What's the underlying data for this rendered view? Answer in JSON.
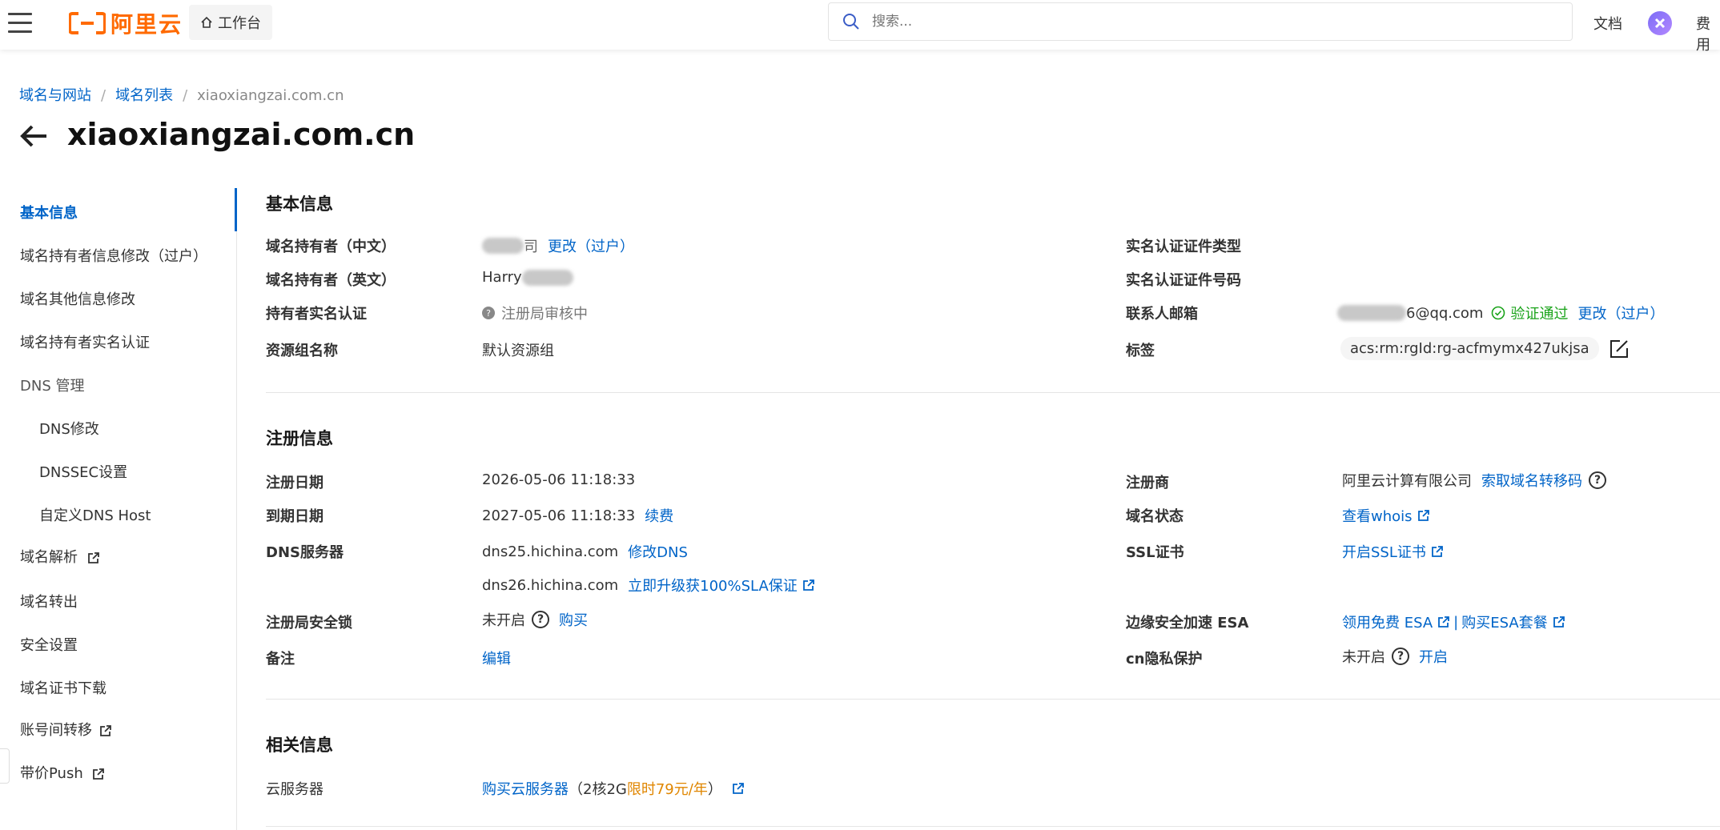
{
  "topbar": {
    "logo_text": "阿里云",
    "workbench_label": "工作台",
    "search_placeholder": "搜索...",
    "docs_label": "文档",
    "fee_label": "费用"
  },
  "header": {
    "breadcrumb": [
      "域名与网站",
      "域名列表",
      "xiaoxiangzai.com.cn"
    ],
    "title": "xiaoxiangzai.com.cn"
  },
  "sidenav": {
    "items": [
      {
        "label": "基本信息",
        "active": true
      },
      {
        "label": "域名持有者信息修改（过户）"
      },
      {
        "label": "域名其他信息修改"
      },
      {
        "label": "域名持有者实名认证"
      },
      {
        "label": "DNS 管理"
      },
      {
        "label": "DNS修改"
      },
      {
        "label": "DNSSEC设置"
      },
      {
        "label": "自定义DNS Host"
      },
      {
        "label": "域名解析"
      },
      {
        "label": "域名转出"
      },
      {
        "label": "安全设置"
      },
      {
        "label": "域名证书下载"
      },
      {
        "label": "账号间转移"
      },
      {
        "label": "带价Push"
      }
    ]
  },
  "basic": {
    "title": "基本信息",
    "owner_cn_label": "域名持有者（中文）",
    "owner_cn_suffix": "司",
    "owner_cn_action": "更改（过户）",
    "owner_en_label": "域名持有者（英文）",
    "owner_en_value": "Harry",
    "realname_label": "持有者实名认证",
    "realname_value": "注册局审核中",
    "resgroup_label": "资源组名称",
    "resgroup_value": "默认资源组",
    "cert_type_label": "实名认证证件类型",
    "cert_no_label": "实名认证证件号码",
    "email_label": "联系人邮箱",
    "email_value": "6@qq.com",
    "email_status": "验证通过",
    "email_action": "更改（过户）",
    "tag_label": "标签",
    "tag_value": "acs:rm:rgId:rg-acfmymx427ukjsa"
  },
  "registration": {
    "title": "注册信息",
    "reg_date_label": "注册日期",
    "reg_date_value": "2026-05-06 11:18:33",
    "exp_date_label": "到期日期",
    "exp_date_value": "2027-05-06 11:18:33",
    "renew_action": "续费",
    "dns_label": "DNS服务器",
    "dns1": "dns25.hichina.com",
    "dns1_action": "修改DNS",
    "dns2": "dns26.hichina.com",
    "dns2_action": "立即升级获100%SLA保证",
    "lock_label": "注册局安全锁",
    "lock_value": "未开启",
    "lock_action": "购买",
    "note_label": "备注",
    "note_action": "编辑",
    "registrar_label": "注册商",
    "registrar_value": "阿里云计算有限公司",
    "registrar_action": "索取域名转移码",
    "status_label": "域名状态",
    "status_action": "查看whois",
    "ssl_label": "SSL证书",
    "ssl_action": "开启SSL证书",
    "esa_label": "边缘安全加速 ESA",
    "esa_action1": "领用免费 ESA",
    "esa_sep": "|",
    "esa_action2": "购买ESA套餐",
    "privacy_label": "cn隐私保护",
    "privacy_value": "未开启",
    "privacy_action": "开启"
  },
  "related": {
    "title": "相关信息",
    "server_label": "云服务器",
    "server_action": "购买云服务器",
    "server_note_pre": "（2核2G",
    "server_note_promo": "限时79元/年",
    "server_note_post": "）"
  },
  "colors": {
    "brand_orange": "#ff6a00",
    "link_blue": "#0064c8",
    "success_green": "#1aa31a",
    "promo_orange": "#e08600"
  }
}
